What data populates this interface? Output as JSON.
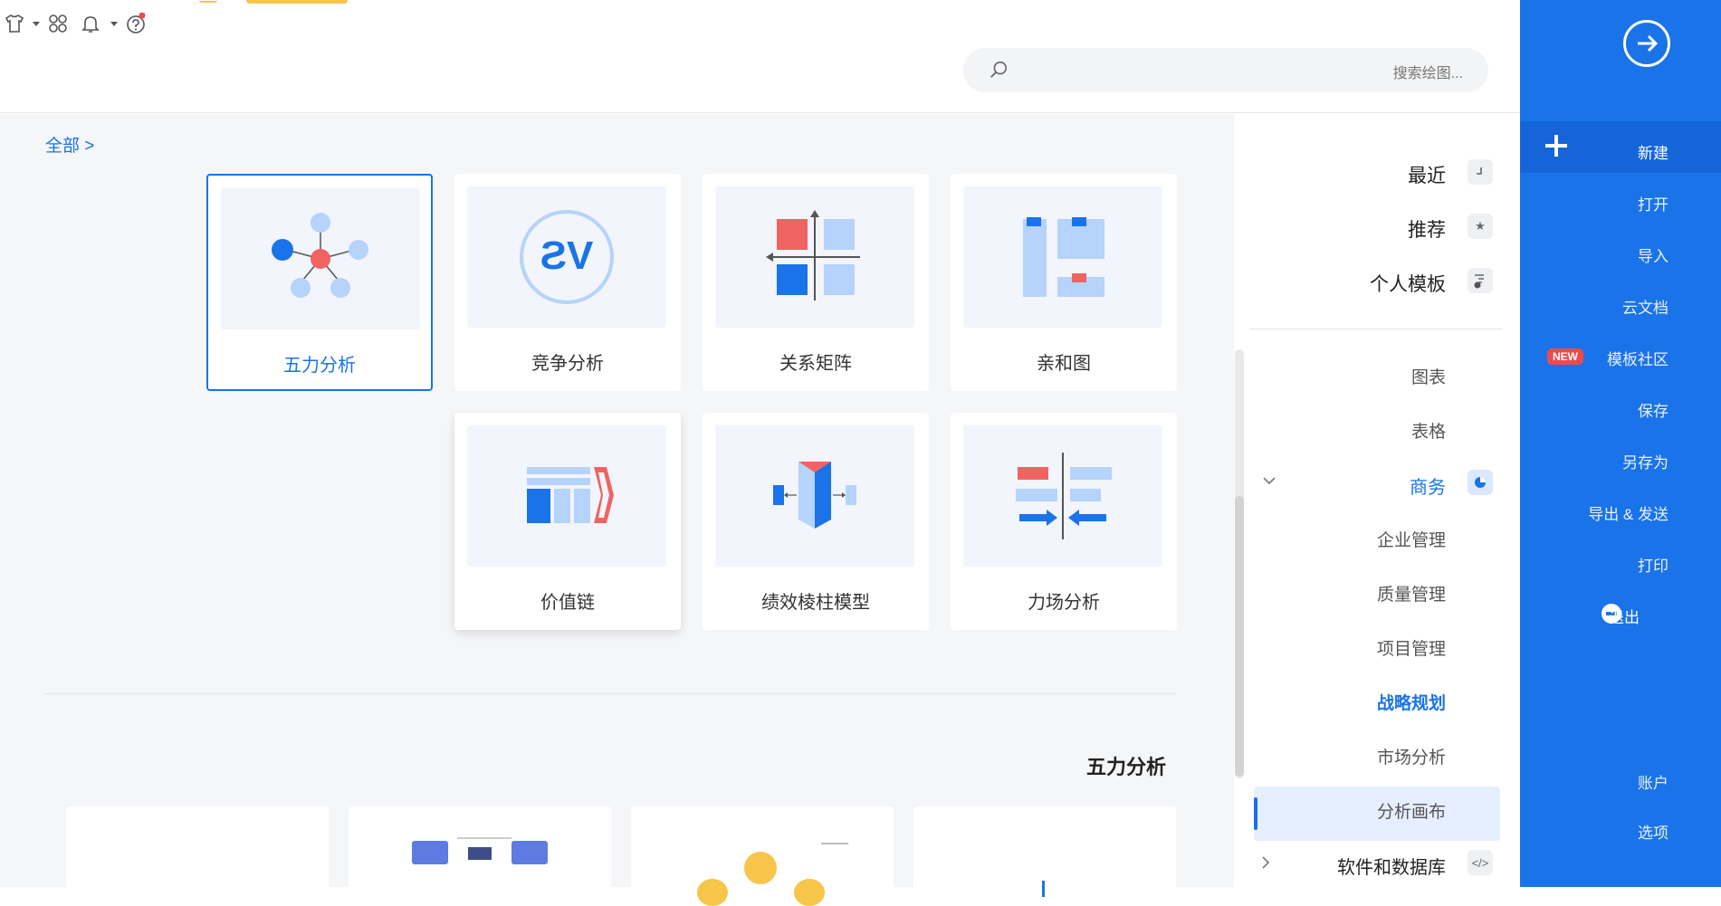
{
  "top_icons": [
    "shirt-icon",
    "apps-icon",
    "bell-icon",
    "help-icon"
  ],
  "search": {
    "placeholder": "搜索绘图..."
  },
  "right_sidebar": {
    "items": [
      {
        "label": "新建"
      },
      {
        "label": "打开"
      },
      {
        "label": "导入"
      },
      {
        "label": "云文档"
      },
      {
        "label": "模板社区",
        "badge": "NEW"
      },
      {
        "label": "保存"
      },
      {
        "label": "另存为"
      },
      {
        "label": "导出 & 发送"
      },
      {
        "label": "打印"
      },
      {
        "label": "退出"
      },
      {
        "label": "账户"
      },
      {
        "label": "选项"
      }
    ]
  },
  "nav": {
    "main": [
      {
        "label": "最近",
        "icon": "clock-icon"
      },
      {
        "label": "推荐",
        "icon": "star-icon"
      },
      {
        "label": "个人模板",
        "icon": "personal-template-icon"
      }
    ],
    "categories": [
      {
        "label": "图表"
      },
      {
        "label": "表格"
      },
      {
        "label": "商务",
        "icon": "pie-icon",
        "expanded": true
      },
      {
        "label": "企业管理"
      },
      {
        "label": "质量管理"
      },
      {
        "label": "项目管理"
      },
      {
        "label": "战略规划",
        "active": true
      },
      {
        "label": "市场分析"
      },
      {
        "label": "分析画布"
      },
      {
        "label": "软件和数据库",
        "icon": "code-icon"
      }
    ]
  },
  "breadcrumb": {
    "label": "全部 >"
  },
  "cards": [
    {
      "label": "五力分析",
      "icon": "five-forces-icon",
      "selected": true
    },
    {
      "label": "竞争分析",
      "icon": "vs-icon"
    },
    {
      "label": "关系矩阵",
      "icon": "matrix-icon"
    },
    {
      "label": "亲和图",
      "icon": "affinity-icon"
    },
    {
      "label": "价值链",
      "icon": "value-chain-icon"
    },
    {
      "label": "绩效棱柱模型",
      "icon": "prism-icon"
    },
    {
      "label": "力场分析",
      "icon": "force-field-icon"
    }
  ],
  "section": {
    "title": "五力分析"
  },
  "colors": {
    "primary": "#1a73e8",
    "accent_red": "#ef6461",
    "light_blue": "#b5d3fb",
    "badge_red": "#ef4a4a"
  }
}
